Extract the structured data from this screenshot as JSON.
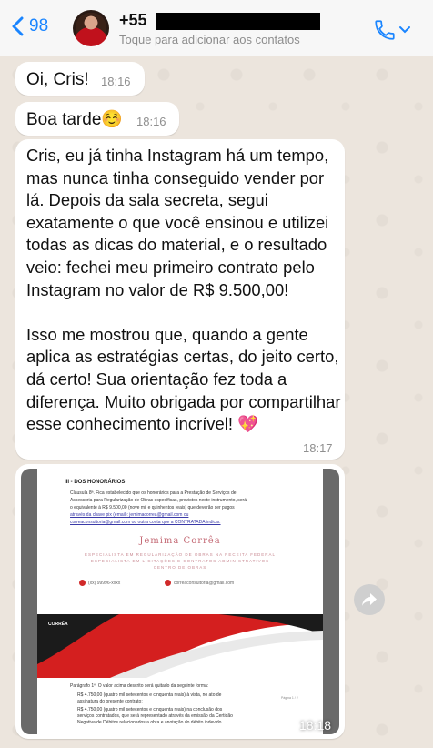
{
  "header": {
    "back_count": "98",
    "contact_name": "+55",
    "contact_subtitle": "Toque para adicionar aos contatos"
  },
  "messages": [
    {
      "text": "Oi, Cris!",
      "time": "18:16"
    },
    {
      "text": "Boa tarde☺️",
      "time": "18:16"
    },
    {
      "text": "Cris, eu já tinha Instagram há um tempo, mas nunca tinha conseguido vender por lá. Depois da sala secreta, segui exatamente o que você ensinou e utilizei todas as dicas do material, e o resultado veio: fechei meu primeiro contrato pelo Instagram no valor de R$ 9.500,00!\n\nIsso me mostrou que, quando a gente aplica as estratégias certas, do jeito certo, dá certo! Sua orientação fez toda a diferença. Muito obrigada por compartilhar esse conhecimento incrível! 💖",
      "time": "18:17"
    }
  ],
  "image_message": {
    "time": "18:18",
    "doc": {
      "section_title": "III - DOS HONORÁRIOS",
      "clause_lines": [
        "Cláusula 8ª. Fica estabelecido que os honorários para a Prestação de Serviços de",
        "Assessoria para Regularização de Obras específicas, previstos neste instrumento, será",
        "o equivalente à R$ 9.500,00 (nove mil e quinhentos reais) que deverão ser pagos",
        "através da chave pix (email): jemimacorrea@gmail.com ou",
        "correaconsultoria@gmail.com ou outra conta que a CONTRATADA indicar."
      ],
      "brand_name": "Jemima Corrêa",
      "brand_lines": [
        "ESPECIALISTA EM REGULARIZAÇÃO DE OBRAS NA RECEITA FEDERAL",
        "ESPECIALISTA EM LICITAÇÕES E CONTRATOS ADMINISTRATIVOS",
        "CENTRO DE OBRAS"
      ],
      "phone": "(xx) 99996-xxxx",
      "email": "correaconsultoria@gmail.com",
      "banner_label": "CORRÊA",
      "paragraph_title": "Parágrafo 1º. O valor acima descrito será quitado da seguinte forma:",
      "bullets": [
        "R$ 4.750,00 (quatro mil setecentos e cinquenta reais) à vista, no ato de",
        "assinatura do presente contrato;",
        "R$ 4.750,00 (quatro mil setecentos e cinquenta reais) na conclusão dos",
        "serviços contratados, que será representado através da emissão da Certidão",
        "Negativa de Débitos relacionados a obra e anotação do débito indevido."
      ],
      "page_number": "Página 1 / 2"
    }
  },
  "colors": {
    "accent": "#1a85ff",
    "wallpaper": "#ece5dd",
    "bubble": "#ffffff",
    "banner_red": "#d41f1f"
  },
  "icons": [
    "back-chevron-icon",
    "phone-icon",
    "chevron-down-icon",
    "forward-icon"
  ]
}
